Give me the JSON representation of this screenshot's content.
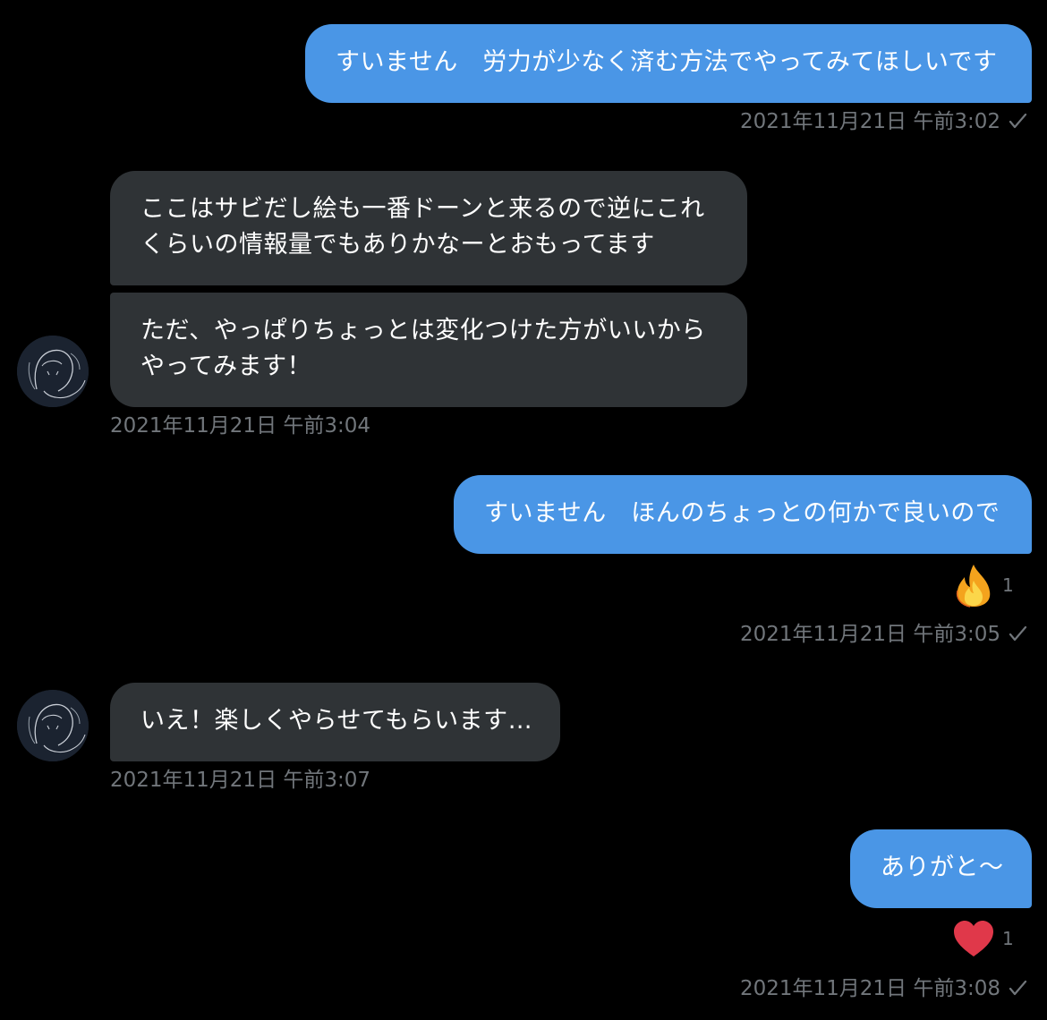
{
  "colors": {
    "background": "#000000",
    "outgoing_bubble": "#4a96e6",
    "incoming_bubble": "#2f3336",
    "timestamp": "#71767b",
    "heart": "#e0384a",
    "fire": "#f7a21b"
  },
  "messages": [
    {
      "direction": "outgoing",
      "text": "すいません　労力が少なく済む方法でやってみてほしいです",
      "timestamp": "2021年11月21日 午前3:02",
      "status_icon": "check-icon"
    },
    {
      "direction": "incoming",
      "avatar_icon": "avatar-sketch-icon",
      "parts": [
        "ここはサビだし絵も一番ドーンと来るので逆にこれ\nくらいの情報量でもありかなーとおもってます",
        "ただ、やっぱりちょっとは変化つけた方がいいから\nやってみます！"
      ],
      "timestamp": "2021年11月21日 午前3:04"
    },
    {
      "direction": "outgoing",
      "text": "すいません　ほんのちょっとの何かで良いので",
      "reaction": {
        "icon": "fire-icon",
        "count": "1"
      },
      "timestamp": "2021年11月21日 午前3:05",
      "status_icon": "check-icon"
    },
    {
      "direction": "incoming",
      "avatar_icon": "avatar-sketch-icon",
      "text": "いえ！楽しくやらせてもらいます…",
      "timestamp": "2021年11月21日 午前3:07"
    },
    {
      "direction": "outgoing",
      "text": "ありがと〜",
      "reaction": {
        "icon": "heart-icon",
        "count": "1"
      },
      "timestamp": "2021年11月21日 午前3:08",
      "status_icon": "check-icon"
    }
  ]
}
